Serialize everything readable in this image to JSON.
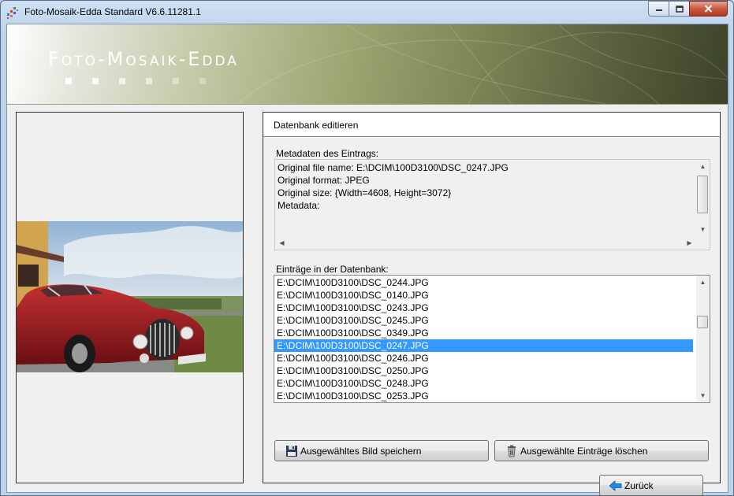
{
  "window": {
    "title": "Foto-Mosaik-Edda Standard V6.6.11281.1"
  },
  "banner": {
    "brand": "Foto-Mosaik-Edda"
  },
  "editor": {
    "title": "Datenbank editieren",
    "metadata_label": "Metadaten des Eintrags:",
    "metadata_lines": [
      "Original file name: E:\\DCIM\\100D3100\\DSC_0247.JPG",
      "Original format: JPEG",
      "Original size: {Width=4608, Height=3072}",
      "Metadata:"
    ],
    "entries_label": "Einträge in der Datenbank:",
    "entries": [
      "E:\\DCIM\\100D3100\\DSC_0244.JPG",
      "E:\\DCIM\\100D3100\\DSC_0140.JPG",
      "E:\\DCIM\\100D3100\\DSC_0243.JPG",
      "E:\\DCIM\\100D3100\\DSC_0245.JPG",
      "E:\\DCIM\\100D3100\\DSC_0349.JPG",
      "E:\\DCIM\\100D3100\\DSC_0247.JPG",
      "E:\\DCIM\\100D3100\\DSC_0246.JPG",
      "E:\\DCIM\\100D3100\\DSC_0250.JPG",
      "E:\\DCIM\\100D3100\\DSC_0248.JPG",
      "E:\\DCIM\\100D3100\\DSC_0253.JPG"
    ],
    "selected_entry": "E:\\DCIM\\100D3100\\DSC_0247.JPG",
    "save_button": "Ausgewähltes Bild speichern",
    "delete_button": "Ausgewählte Einträge löschen",
    "back_button": "Zurück"
  },
  "colors": {
    "selection": "#3399ff",
    "close_button": "#c75a41",
    "back_arrow": "#1f8ae0"
  },
  "icons": [
    "app-mosaic-icon",
    "minimize-icon",
    "maximize-icon",
    "close-icon",
    "floppy-disk-icon",
    "trash-icon",
    "back-arrow-icon"
  ]
}
